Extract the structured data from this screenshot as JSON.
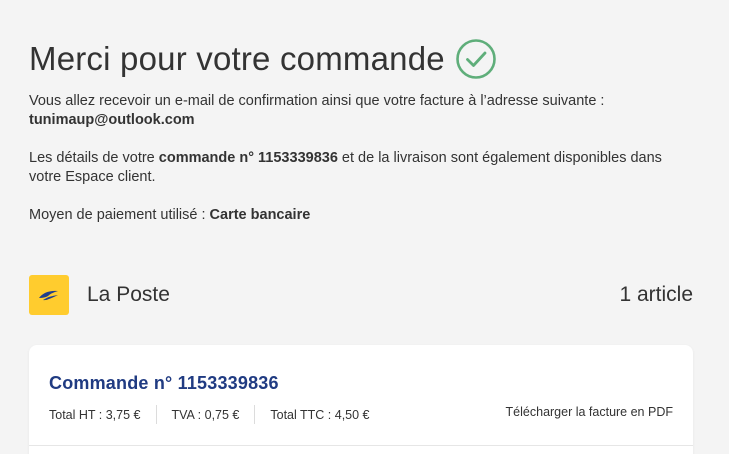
{
  "header": {
    "title": "Merci pour votre commande"
  },
  "confirmation": {
    "email_intro": "Vous allez recevoir un e-mail de confirmation ainsi que votre facture à l’adresse suivante :",
    "email": "tunimaup@outlook.com",
    "details_prefix": "Les détails de votre ",
    "order_ref_label": "commande n° 1153339836",
    "details_suffix": " et de la livraison sont également disponibles dans votre Espace client.",
    "payment_label": "Moyen de paiement utilisé : ",
    "payment_method": "Carte bancaire"
  },
  "carrier": {
    "name": "La Poste",
    "article_count": "1 article"
  },
  "order_card": {
    "title": "Commande n° 1153339836",
    "total_ht": "Total HT : 3,75 €",
    "tva": "TVA : 0,75 €",
    "total_ttc": "Total TTC : 4,50 €",
    "invoice_link": "Télécharger la facture en PDF"
  },
  "colors": {
    "success": "#5fae7a",
    "brand_yellow": "#ffcc2e",
    "order_title": "#203b82",
    "background": "#f4f4f4"
  },
  "icons": {
    "check": "check-circle-icon",
    "logo": "la-poste-logo"
  }
}
